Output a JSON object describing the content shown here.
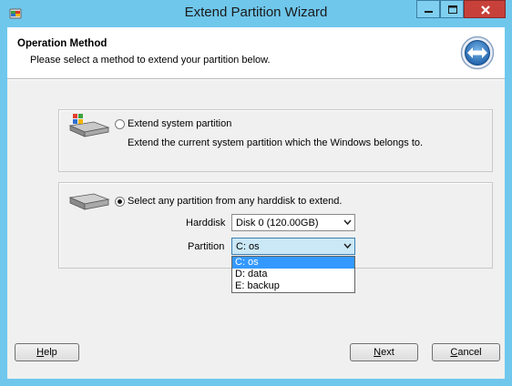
{
  "window": {
    "title": "Extend Partition Wizard",
    "controls": {
      "minimize": "minimize-icon",
      "maximize": "maximize-icon",
      "close": "close-icon"
    }
  },
  "header": {
    "title": "Operation Method",
    "subtitle": "Please select a method to extend your partition below.",
    "logo_icon": "arrows-logo-icon"
  },
  "options": [
    {
      "label": "Extend system partition",
      "description": "Extend the current system partition which the Windows belongs to.",
      "selected": false,
      "icon": "system-disk-icon"
    },
    {
      "label": "Select any partition from any harddisk to extend.",
      "selected": true,
      "icon": "harddisk-icon"
    }
  ],
  "harddisk": {
    "label": "Harddisk",
    "value": "Disk 0 (120.00GB)"
  },
  "partition": {
    "label": "Partition",
    "value": "C: os",
    "options": [
      "C: os",
      "D: data",
      "E: backup"
    ],
    "selected_index": 0
  },
  "buttons": {
    "help": {
      "first": "H",
      "rest": "elp"
    },
    "next": {
      "first": "N",
      "rest": "ext"
    },
    "cancel": {
      "first": "C",
      "rest": "ancel"
    }
  },
  "colors": {
    "titlebar": "#6fc7ec",
    "close": "#c7413a",
    "highlight": "#3399ff"
  }
}
